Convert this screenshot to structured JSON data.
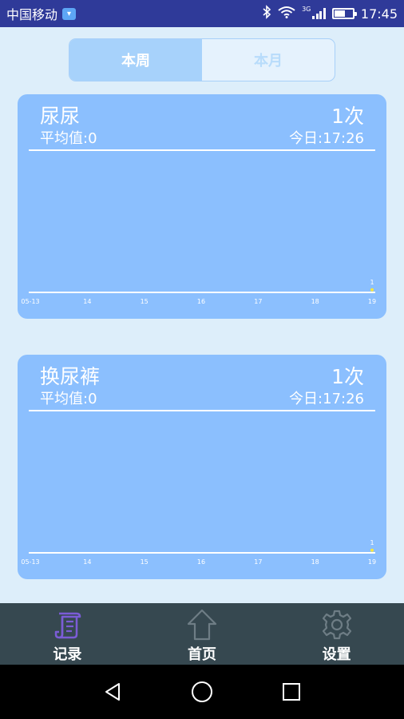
{
  "status_bar": {
    "carrier": "中国移动",
    "network_type": "3G",
    "time": "17:45",
    "battery_level": 0.6,
    "icons": [
      "carrier-badge-icon",
      "bluetooth-icon",
      "wifi-icon",
      "signal-icon",
      "battery-icon"
    ]
  },
  "tabs": [
    {
      "label": "本周",
      "active": true
    },
    {
      "label": "本月",
      "active": false
    }
  ],
  "cards": [
    {
      "title": "尿尿",
      "count": "1次",
      "average": "平均值:0",
      "today": "今日:17:26",
      "chart_data": {
        "type": "line",
        "categories": [
          "05-13",
          "14",
          "15",
          "16",
          "17",
          "18",
          "19"
        ],
        "values": [
          0,
          0,
          0,
          0,
          0,
          0,
          1
        ],
        "data_labels": [
          "",
          "",
          "",
          "",
          "",
          "",
          "1"
        ],
        "point_color": "#f5e642"
      }
    },
    {
      "title": "换尿裤",
      "count": "1次",
      "average": "平均值:0",
      "today": "今日:17:26",
      "chart_data": {
        "type": "line",
        "categories": [
          "05-13",
          "14",
          "15",
          "16",
          "17",
          "18",
          "19"
        ],
        "values": [
          0,
          0,
          0,
          0,
          0,
          0,
          1
        ],
        "data_labels": [
          "",
          "",
          "",
          "",
          "",
          "",
          "1"
        ],
        "point_color": "#f5e642"
      }
    }
  ],
  "bottom_nav": [
    {
      "label": "记录",
      "icon": "scroll-icon",
      "active": true
    },
    {
      "label": "首页",
      "icon": "home-icon",
      "active": false
    },
    {
      "label": "设置",
      "icon": "gear-icon",
      "active": false
    }
  ],
  "system_nav": [
    "back-icon",
    "home-circle-icon",
    "recents-icon"
  ],
  "colors": {
    "status_bar": "#2f3a99",
    "background": "#ddeefa",
    "card": "#8bbffe",
    "tab_active": "#a7d2fb",
    "bottom_nav": "#364850",
    "active_nav_icon": "#7b5cd6",
    "point": "#f5e642"
  }
}
